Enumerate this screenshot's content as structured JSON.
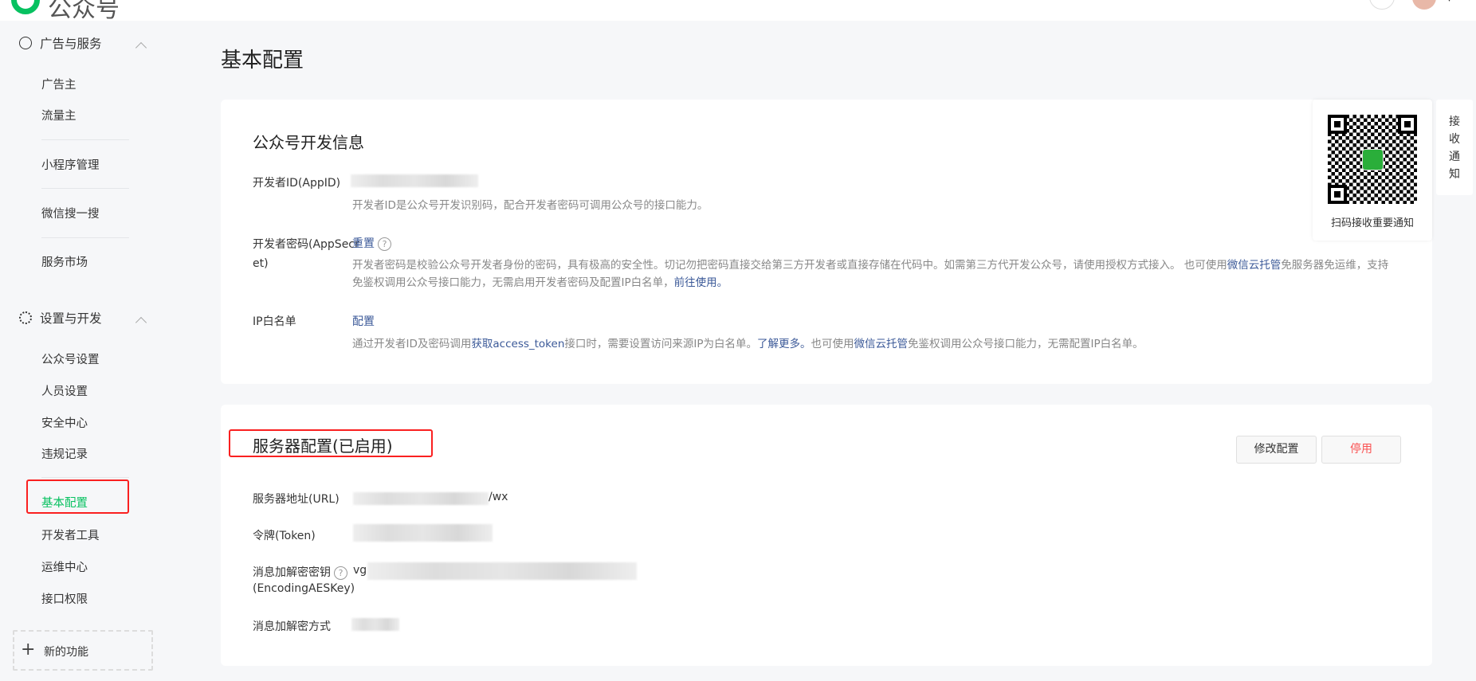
{
  "header": {
    "logo_text": "公众号"
  },
  "sidebar": {
    "group1": {
      "label": "广告与服务",
      "items": [
        "广告主",
        "流量主",
        "小程序管理",
        "微信搜一搜",
        "服务市场"
      ]
    },
    "group2": {
      "label": "设置与开发",
      "items": [
        "公众号设置",
        "人员设置",
        "安全中心",
        "违规记录",
        "基本配置",
        "开发者工具",
        "运维中心",
        "接口权限"
      ]
    },
    "new_feature": "新的功能"
  },
  "page": {
    "title": "基本配置"
  },
  "dev_info": {
    "title": "公众号开发信息",
    "appid_label": "开发者ID(AppID)",
    "appid_desc": "开发者ID是公众号开发识别码，配合开发者密码可调用公众号的接口能力。",
    "secret_label": "开发者密码(AppSecret)",
    "secret_reset": "重置",
    "secret_desc_1": "开发者密码是校验公众号开发者身份的密码，具有极高的安全性。切记勿把密码直接交给第三方开发者或直接存储在代码中。如需第三方代开发公众号，请使用授权方式接入。 也可使用",
    "secret_desc_link1": "微信云托管",
    "secret_desc_2": "免服务器免运维，支持免鉴权调用公众号接口能力，无需启用开发者密码及配置IP白名单，",
    "secret_desc_link2": "前往使用。",
    "ip_label": "IP白名单",
    "ip_config": "配置",
    "ip_desc_1": "通过开发者ID及密码调用",
    "ip_desc_link1": "获取access_token",
    "ip_desc_2": "接口时，需要设置访问来源IP为白名单。",
    "ip_desc_link2": "了解更多。",
    "ip_desc_3": "也可使用",
    "ip_desc_link3": "微信云托管",
    "ip_desc_4": "免鉴权调用公众号接口能力，无需配置IP白名单。"
  },
  "server": {
    "title": "服务器配置(已启用)",
    "modify_button": "修改配置",
    "disable_button": "停用",
    "url_label": "服务器地址(URL)",
    "url_value_suffix": "/wx",
    "token_label": "令牌(Token)",
    "aes_label_1": "消息加解密密钥",
    "aes_label_2": "(EncodingAESKey)",
    "aes_value_prefix": "vg",
    "method_label": "消息加解密方式"
  },
  "qr_popover": {
    "caption": "扫码接收重要通知"
  },
  "side_tab": {
    "chars": [
      "接",
      "收",
      "通",
      "知"
    ]
  },
  "colors": {
    "accent": "#07c160",
    "danger": "#fa5151",
    "link": "#3b5998",
    "highlight": "#fa2020"
  }
}
